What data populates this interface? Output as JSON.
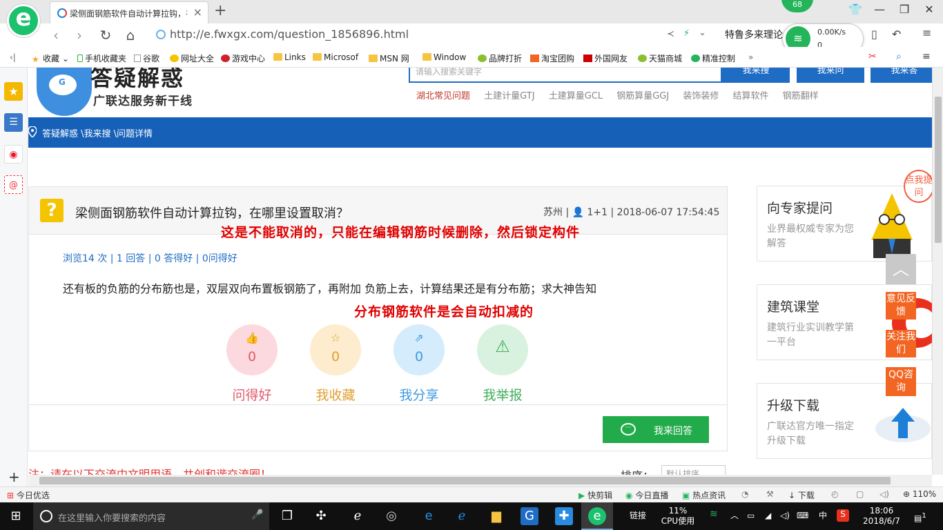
{
  "browser": {
    "tab_title": "梁侧面钢筋软件自动计算拉钩，在",
    "badge": "68",
    "url": "http://e.fwxgx.com/question_1856896.html",
    "ticker": "特鲁多来理论",
    "net_speed": "0.00K/s",
    "net_count": "0",
    "bookmarks": [
      "收藏",
      "手机收藏夹",
      "谷歌",
      "网址大全",
      "游戏中心",
      "Links",
      "Microsof",
      "MSN 网",
      "Window",
      "品牌打折",
      "淘宝团购",
      "外国网友",
      "天猫商城",
      "精准控制"
    ],
    "more": "»"
  },
  "site": {
    "title": "答疑解惑",
    "subtitle": "广联达服务新干线",
    "search_placeholder": "请输入搜索关键字",
    "search_buttons": [
      "我来搜",
      "我来问",
      "我来答"
    ],
    "links": [
      "湖北常见问题",
      "土建计量GTJ",
      "土建算量GCL",
      "钢筋算量GGJ",
      "装饰装修",
      "结算软件",
      "钢筋翻样"
    ],
    "breadcrumb": "答疑解惑 \\我来搜 \\问题详情"
  },
  "question": {
    "title": "梁侧面钢筋软件自动计算拉钩，在哪里设置取消？",
    "meta": "苏州 | 👤 1+1 | 2018-06-07 17:54:45",
    "stats": "浏览14 次 | 1 回答 | 0 答得好 | 0问得好",
    "body": "还有板的负筋的分布筋也是，双层双向布置板钢筋了，再附加 负筋上去，计算结果还是有分布筋；求大神告知",
    "annotation1": "这是不能取消的，只能在编辑钢筋时候删除，然后锁定构件",
    "annotation2": "分布钢筋软件是会自动扣减的",
    "actions": [
      {
        "label": "问得好",
        "count": "0",
        "icon": "thumb-up-icon",
        "bg": "#fcd9de",
        "color": "#e05a6b"
      },
      {
        "label": "我收藏",
        "count": "0",
        "icon": "star-icon",
        "bg": "#fdeccd",
        "color": "#e0a030"
      },
      {
        "label": "我分享",
        "count": "0",
        "icon": "share-icon",
        "bg": "#d4ecfb",
        "color": "#3b9ae0"
      },
      {
        "label": "我举报",
        "count": "",
        "icon": "warning-icon",
        "bg": "#d9f2df",
        "color": "#3fae5a"
      }
    ],
    "answer_button": "我来回答",
    "note": "注：请在以下交流中文明用语，共创和谐交流圈！",
    "sort_label": "排序：",
    "sort_value": "默认排序"
  },
  "sidebar": {
    "cards": [
      {
        "title": "向专家提问",
        "desc": "业界最权威专家为您解答"
      },
      {
        "title": "建筑课堂",
        "desc": "建筑行业实训教学第一平台"
      },
      {
        "title": "升级下载",
        "desc": "广联达官方唯一指定升级下载"
      }
    ],
    "ribbon": "点我提问",
    "float_buttons": [
      "意见反馈",
      "关注我们",
      "QQ咨询"
    ]
  },
  "statusbar": {
    "left": "今日优选",
    "items": [
      "快剪辑",
      "今日直播",
      "热点资讯",
      "下载"
    ],
    "zoom": "110%"
  },
  "taskbar": {
    "search_placeholder": "在这里输入你要搜索的内容",
    "link_label": "链接",
    "cpu_percent": "11%",
    "cpu_label": "CPU使用",
    "ime": "中",
    "time": "18:06",
    "date": "2018/6/7",
    "notif": "1"
  },
  "colors": {
    "brand_blue": "#1760b8",
    "answer_green": "#22ab4b",
    "annotation_red": "#e00000",
    "float_orange": "#f26522"
  }
}
